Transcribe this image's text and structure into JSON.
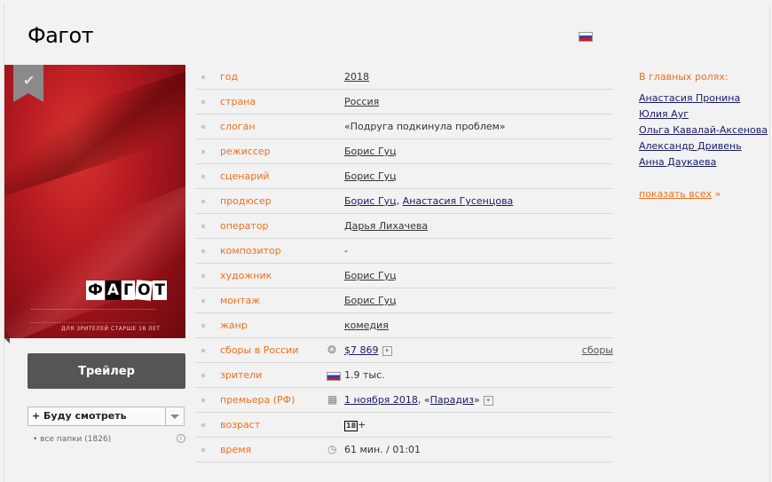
{
  "movie": {
    "title": "Фагот",
    "poster_logo_letters": [
      "Ф",
      "А",
      "Г",
      "О",
      "Т"
    ],
    "poster_age_text": "ДЛЯ ЗРИТЕЛЕЙ СТАРШЕ 18 ЛЕТ"
  },
  "actions": {
    "trailer_label": "Трейлер",
    "watch_label": "+ Буду смотреть",
    "folders_label": "все папки (1826)"
  },
  "info": {
    "year": {
      "key": "год",
      "value": "2018"
    },
    "country": {
      "key": "страна",
      "value": "Россия"
    },
    "slogan": {
      "key": "слоган",
      "value": "«Подруга подкинула проблем»"
    },
    "director": {
      "key": "режиссер",
      "value": "Борис Гуц"
    },
    "writer": {
      "key": "сценарий",
      "value": "Борис Гуц"
    },
    "producer": {
      "key": "продюсер",
      "value1": "Борис Гуц",
      "sep": ",",
      "value2": "Анастасия Гусенцова"
    },
    "operator": {
      "key": "оператор",
      "value": "Дарья Лихачева"
    },
    "composer": {
      "key": "композитор",
      "value": "-"
    },
    "artist": {
      "key": "художник",
      "value": "Борис Гуц"
    },
    "editing": {
      "key": "монтаж",
      "value": "Борис Гуц"
    },
    "genre": {
      "key": "жанр",
      "value": "комедия"
    },
    "boxoffice": {
      "key": "сборы в России",
      "value": "$7 869",
      "link": "сборы"
    },
    "viewers": {
      "key": "зрители",
      "value": "1.9 тыс."
    },
    "premiere": {
      "key": "премьера (РФ)",
      "date": "1 ноября 2018",
      "sep": ", «",
      "distributor": "Парадиз",
      "close": "»"
    },
    "age": {
      "key": "возраст",
      "badge": "18",
      "plus": "+"
    },
    "time": {
      "key": "время",
      "value": "61 мин. / 01:01"
    }
  },
  "cast": {
    "header": "В главных ролях:",
    "actors": [
      "Анастасия Пронина",
      "Юлия Ауг",
      "Ольга Кавалай-Аксенова",
      "Александр Дривень",
      "Анна Даукаева"
    ],
    "show_all": "показать всех",
    "show_all_arrow": "»"
  },
  "colors": {
    "accent": "#f06f1e",
    "link": "#1a1a66",
    "button": "#555555"
  },
  "icons": [
    "russia-flag-icon",
    "bookmark-icon",
    "checkmark-icon",
    "chevron-down-icon",
    "info-icon",
    "coins-icon",
    "calendar-icon",
    "clock-icon",
    "dropdown-icon"
  ]
}
